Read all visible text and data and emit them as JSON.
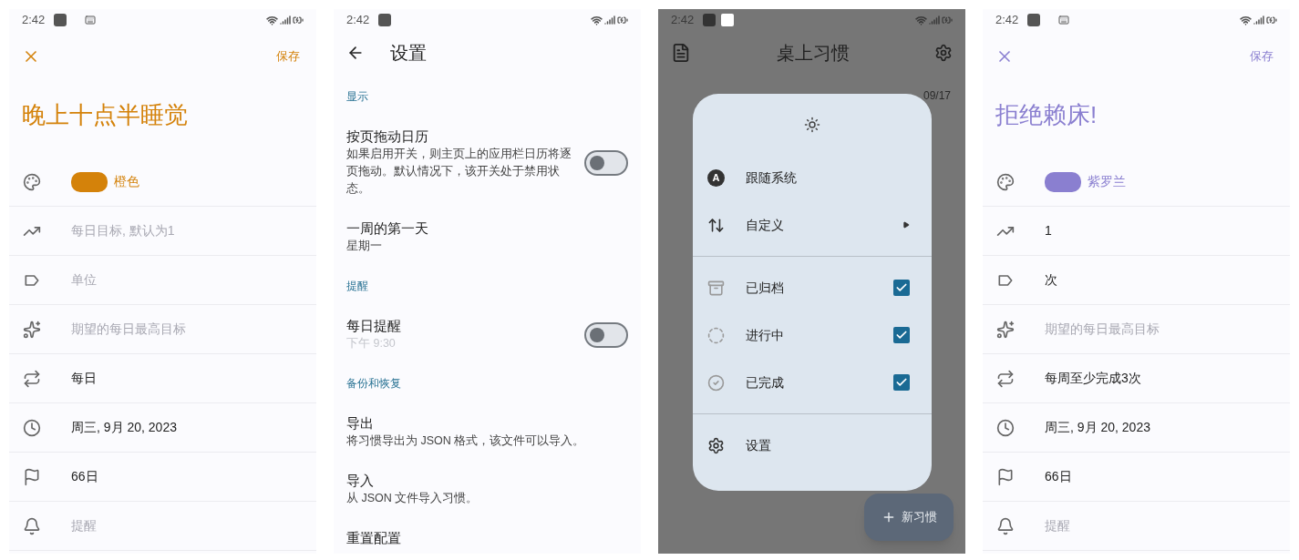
{
  "screens": [
    {
      "kind": "habit_form",
      "status_bar": {
        "time": "2:42",
        "keyboard": true
      },
      "color": "#d4820a",
      "save": "保存",
      "title": "晚上十点半睡觉",
      "color_name": "橙色",
      "rows": [
        {
          "placeholder": "每日目标, 默认为1"
        },
        {
          "placeholder": "单位"
        },
        {
          "placeholder": "期望的每日最高目标"
        },
        {
          "value": "每日"
        },
        {
          "value": "周三, 9月 20, 2023"
        },
        {
          "value": "66日"
        },
        {
          "placeholder": "提醒"
        }
      ]
    },
    {
      "kind": "settings",
      "status_bar": {
        "time": "2:42",
        "keyboard": false
      },
      "title": "设置",
      "items": [
        {
          "kind": "section",
          "label": "显示"
        },
        {
          "kind": "switch",
          "title": "按页拖动日历",
          "description": "如果启用开关，则主页上的应用栏日历将逐页拖动。默认情况下，该开关处于禁用状态。",
          "on": false
        },
        {
          "kind": "option",
          "title": "一周的第一天",
          "description": "星期一"
        },
        {
          "kind": "section",
          "label": "提醒"
        },
        {
          "kind": "switch",
          "title": "每日提醒",
          "description": "下午 9:30",
          "disabled": true,
          "on": false
        },
        {
          "kind": "section",
          "label": "备份和恢复"
        },
        {
          "kind": "option",
          "title": "导出",
          "description": "将习惯导出为 JSON 格式，该文件可以导入。"
        },
        {
          "kind": "option",
          "title": "导入",
          "description": "从 JSON 文件导入习惯。"
        },
        {
          "kind": "option",
          "title": "重置配置"
        }
      ]
    },
    {
      "kind": "home_menu",
      "status_bar": {
        "time": "2:42",
        "keyboard": false
      },
      "title": "桌上习惯",
      "date": "09/17",
      "fab": "新习惯",
      "menu": [
        {
          "kind": "header"
        },
        {
          "kind": "item",
          "badge": "A",
          "label": "跟随系统"
        },
        {
          "kind": "submenu",
          "label": "自定义"
        },
        {
          "kind": "divider"
        },
        {
          "kind": "check",
          "label": "已归档",
          "checked": true
        },
        {
          "kind": "check",
          "label": "进行中",
          "checked": true
        },
        {
          "kind": "check",
          "label": "已完成",
          "checked": true
        },
        {
          "kind": "divider"
        },
        {
          "kind": "item",
          "label": "设置"
        }
      ]
    },
    {
      "kind": "habit_form",
      "status_bar": {
        "time": "2:42",
        "keyboard": true
      },
      "color": "#8a7fd0",
      "save": "保存",
      "title": "拒绝赖床!",
      "color_name": "紫罗兰",
      "rows": [
        {
          "value": "1"
        },
        {
          "value": "次"
        },
        {
          "placeholder": "期望的每日最高目标"
        },
        {
          "value": "每周至少完成3次"
        },
        {
          "value": "周三, 9月 20, 2023"
        },
        {
          "value": "66日"
        },
        {
          "placeholder": "提醒"
        }
      ]
    }
  ]
}
